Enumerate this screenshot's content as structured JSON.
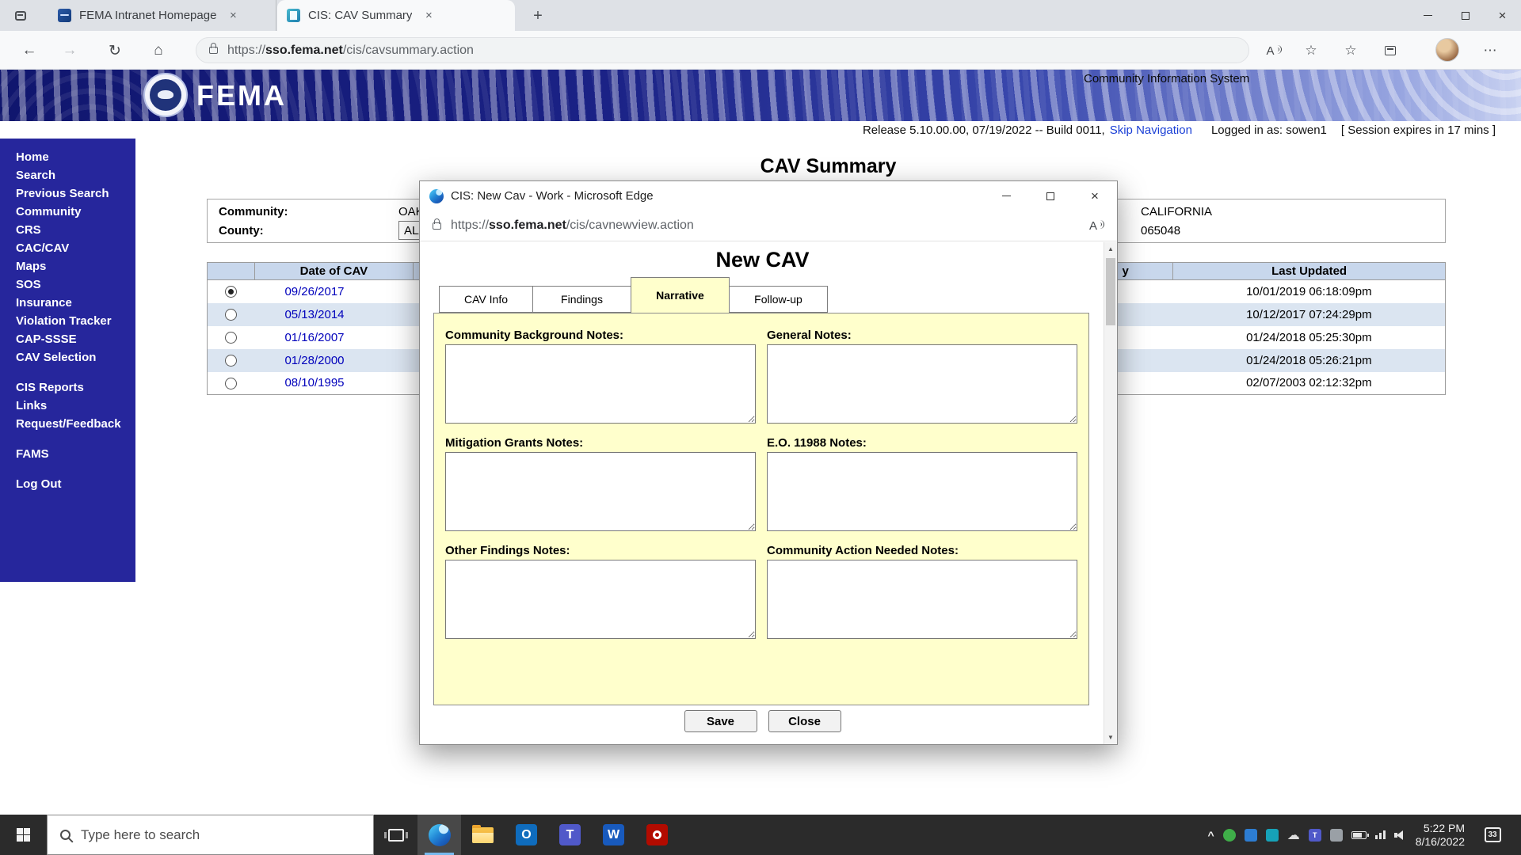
{
  "browser": {
    "tab1": {
      "title": "FEMA Intranet Homepage"
    },
    "tab2": {
      "title": "CIS: CAV Summary"
    },
    "address": {
      "prefix": "https://",
      "domain": "sso.fema.net",
      "path": "/cis/cavsummary.action"
    }
  },
  "header": {
    "brand": "FEMA",
    "system_title": "Community Information System",
    "release_text": "Release 5.10.00.00, 07/19/2022 -- Build 0011,",
    "skip_navigation": "Skip Navigation",
    "logged_in": "Logged in as: sowen1",
    "session": "[ Session expires in 17 mins ]"
  },
  "sidebar": {
    "items": [
      {
        "label": "Home"
      },
      {
        "label": "Search"
      },
      {
        "label": "Previous Search"
      },
      {
        "label": "Community"
      },
      {
        "label": "CRS"
      },
      {
        "label": "CAC/CAV"
      },
      {
        "label": "Maps"
      },
      {
        "label": "SOS"
      },
      {
        "label": "Insurance"
      },
      {
        "label": "Violation Tracker"
      },
      {
        "label": "CAP-SSSE"
      },
      {
        "label": "CAV Selection"
      },
      {
        "label": "CIS Reports"
      },
      {
        "label": "Links"
      },
      {
        "label": "Request/Feedback"
      },
      {
        "label": "FAMS"
      },
      {
        "label": "Log Out"
      }
    ]
  },
  "main": {
    "title": "CAV Summary",
    "community_label": "Community:",
    "community_value": "OAK",
    "county_label": "County:",
    "county_value": "ALA",
    "state": "CALIFORNIA",
    "community_id": "065048",
    "table": {
      "col_date": "Date of CAV",
      "col_partial": "y",
      "col_updated": "Last Updated",
      "rows": [
        {
          "date": "09/26/2017",
          "updated": "10/01/2019 06:18:09pm",
          "selected": true
        },
        {
          "date": "05/13/2014",
          "updated": "10/12/2017 07:24:29pm",
          "selected": false
        },
        {
          "date": "01/16/2007",
          "updated": "01/24/2018 05:25:30pm",
          "selected": false
        },
        {
          "date": "01/28/2000",
          "updated": "01/24/2018 05:26:21pm",
          "selected": false
        },
        {
          "date": "08/10/1995",
          "updated": "02/07/2003 02:12:32pm",
          "selected": false
        }
      ]
    }
  },
  "popup": {
    "title": "CIS: New Cav - Work - Microsoft Edge",
    "address": {
      "prefix": "https://",
      "domain": "sso.fema.net",
      "path": "/cis/cavnewview.action"
    },
    "heading": "New CAV",
    "tabs": [
      {
        "label": "CAV Info"
      },
      {
        "label": "Findings"
      },
      {
        "label": "Narrative"
      },
      {
        "label": "Follow-up"
      }
    ],
    "active_tab": "Narrative",
    "fields": [
      {
        "label": "Community Background Notes:",
        "value": ""
      },
      {
        "label": "General Notes:",
        "value": ""
      },
      {
        "label": "Mitigation Grants Notes:",
        "value": ""
      },
      {
        "label": "E.O. 11988 Notes:",
        "value": ""
      },
      {
        "label": "Other Findings Notes:",
        "value": ""
      },
      {
        "label": "Community Action Needed Notes:",
        "value": ""
      }
    ],
    "save_label": "Save",
    "close_label": "Close"
  },
  "taskbar": {
    "search_placeholder": "Type here to search",
    "clock": {
      "time": "5:22 PM",
      "date": "8/16/2022"
    },
    "notification_count": "33"
  },
  "icons": {
    "back": "←",
    "forward": "→",
    "refresh": "↻",
    "home": "⌂",
    "new_tab": "+",
    "close_x": "×",
    "star": "☆",
    "more": "⋯",
    "read_aloud": "A",
    "scroll_up": "▲",
    "scroll_down": "▼",
    "dropdown": "▼",
    "chevron_up": "^",
    "cloud": "☁",
    "outlook_letter": "O",
    "word_letter": "W",
    "teams_letter": "T"
  },
  "colors": {
    "sidebar_bg": "#26269c",
    "panel_yellow": "#ffffcc",
    "table_header": "#c8d7ec",
    "row_alt": "#dbe5f1",
    "link_blue": "#0000bb"
  }
}
